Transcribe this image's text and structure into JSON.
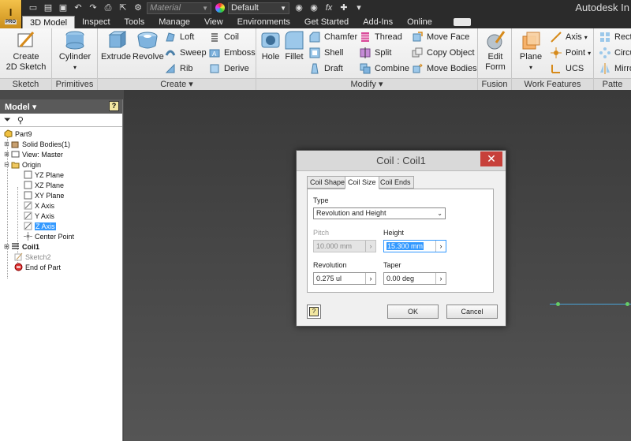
{
  "app": {
    "title": "Autodesk In",
    "app_button_letter": "I",
    "app_button_badge": "PRO",
    "material_combo": "Material",
    "appearance_combo": "Default",
    "fx_label": "fx"
  },
  "tabs": [
    "3D Model",
    "Inspect",
    "Tools",
    "Manage",
    "View",
    "Environments",
    "Get Started",
    "Add-Ins",
    "Online"
  ],
  "ribbon": {
    "panels": {
      "sketch": "Sketch",
      "primitives": "Primitives",
      "create": "Create ▾",
      "modify": "Modify ▾",
      "fusion": "Fusion",
      "work_features": "Work Features",
      "pattern": "Patte"
    },
    "create_2d_sketch": "Create\n2D Sketch",
    "create_2d_sketch_l1": "Create",
    "create_2d_sketch_l2": "2D Sketch",
    "cylinder": "Cylinder",
    "extrude": "Extrude",
    "revolve": "Revolve",
    "loft": "Loft",
    "sweep": "Sweep",
    "rib": "Rib",
    "coil": "Coil",
    "emboss": "Emboss",
    "derive": "Derive",
    "hole": "Hole",
    "fillet": "Fillet",
    "chamfer": "Chamfer",
    "shell": "Shell",
    "draft": "Draft",
    "thread": "Thread",
    "split": "Split",
    "combine": "Combine",
    "move_face": "Move Face",
    "copy_object": "Copy Object",
    "move_bodies": "Move Bodies",
    "edit_form_l1": "Edit",
    "edit_form_l2": "Form",
    "plane": "Plane",
    "axis": "Axis",
    "point": "Point",
    "ucs": "UCS",
    "rect": "Recta",
    "circ": "Circu",
    "mirr": "Mirro"
  },
  "browser": {
    "title": "Model ▾",
    "tree": [
      {
        "label": "Part9"
      },
      {
        "label": "Solid Bodies(1)"
      },
      {
        "label": "View: Master"
      },
      {
        "label": "Origin"
      },
      {
        "label": "YZ Plane"
      },
      {
        "label": "XZ Plane"
      },
      {
        "label": "XY Plane"
      },
      {
        "label": "X Axis"
      },
      {
        "label": "Y Axis"
      },
      {
        "label": "Z Axis"
      },
      {
        "label": "Center Point"
      },
      {
        "label": "Coil1"
      },
      {
        "label": "Sketch2"
      },
      {
        "label": "End of Part"
      }
    ]
  },
  "dialog": {
    "title": "Coil : Coil1",
    "close": "✕",
    "tabs": [
      "Coil Shape",
      "Coil Size",
      "Coil Ends"
    ],
    "type_label": "Type",
    "type_value": "Revolution and Height",
    "pitch_label": "Pitch",
    "pitch_value": "10.000 mm",
    "height_label": "Height",
    "height_value": "15.300 mm",
    "revolution_label": "Revolution",
    "revolution_value": "0.275 ul",
    "taper_label": "Taper",
    "taper_value": "0.00 deg",
    "ok": "OK",
    "cancel": "Cancel"
  }
}
